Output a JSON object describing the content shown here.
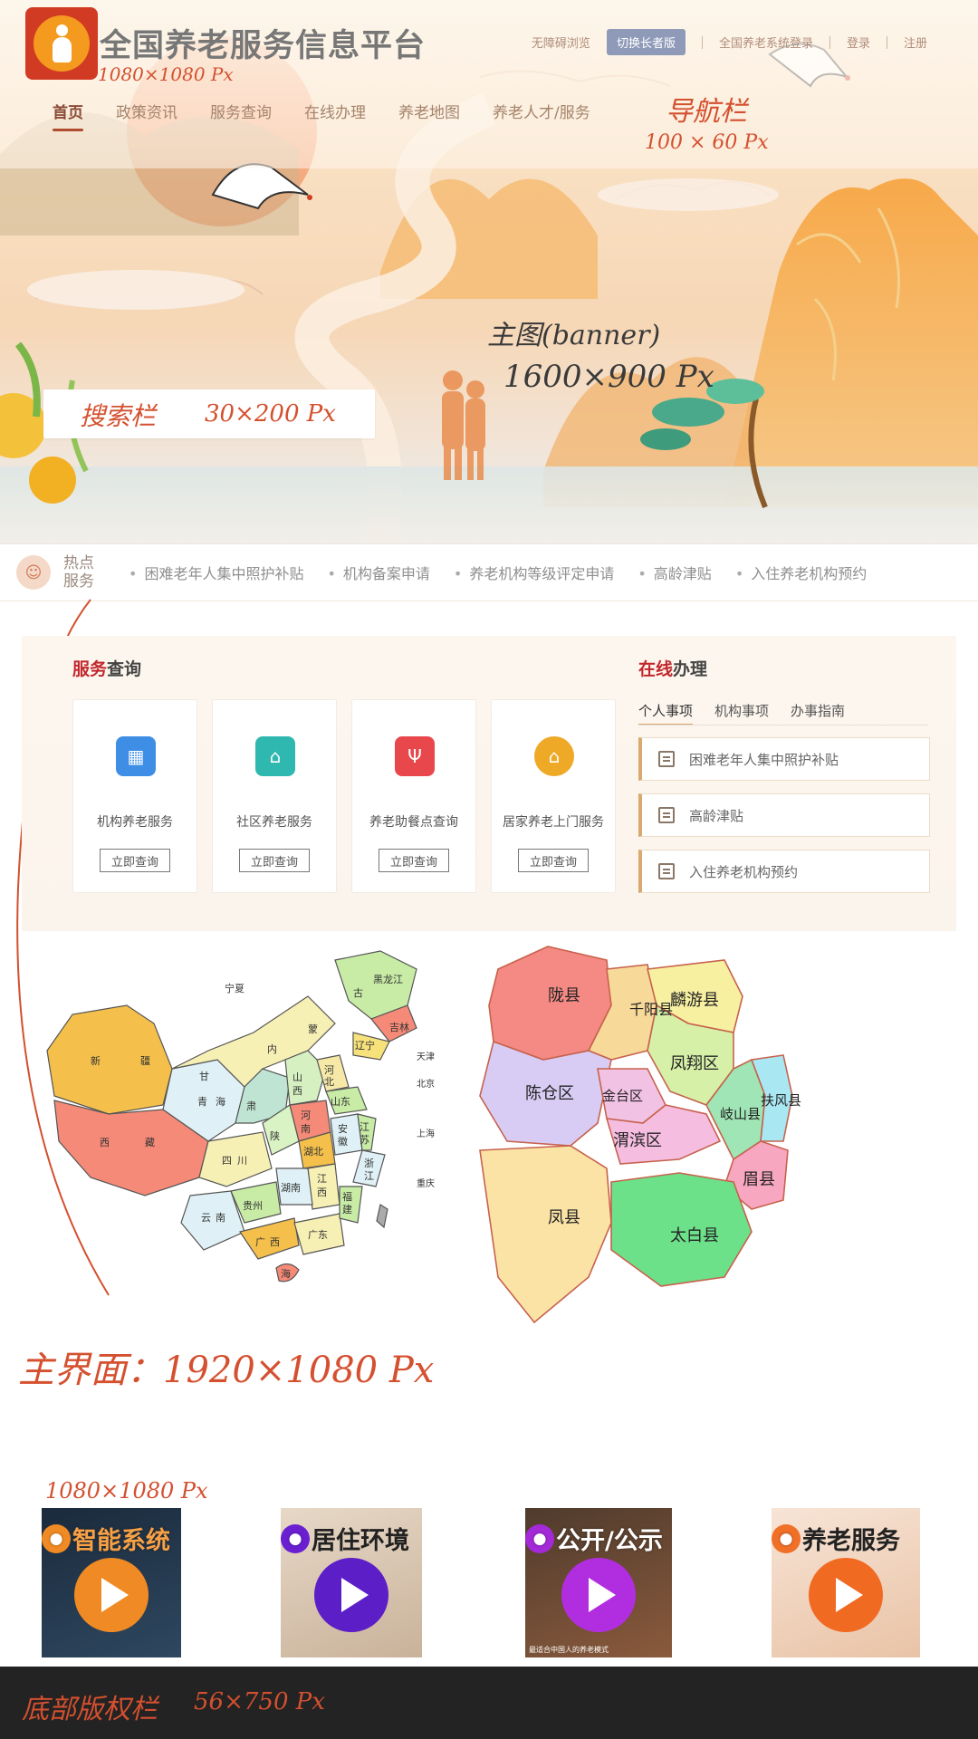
{
  "header": {
    "site_title": "全国养老服务信息平台",
    "top_links": {
      "accessibility": "无障碍浏览",
      "elder_mode": "切换长者版",
      "system_login": "全国养老系统登录",
      "login": "登录",
      "register": "注册"
    },
    "nav": [
      {
        "label": "首页",
        "active": true
      },
      {
        "label": "政策资讯"
      },
      {
        "label": "服务查询"
      },
      {
        "label": "在线办理"
      },
      {
        "label": "养老地图"
      },
      {
        "label": "养老人才/服务"
      }
    ]
  },
  "annotations": {
    "logo_size": "1080×1080 Px",
    "nav_label": "导航栏",
    "nav_size": "100 × 60 Px",
    "banner_label": "主图(banner)",
    "banner_size": "1600×900 Px",
    "search_label": "搜索栏",
    "search_size": "30×200 Px",
    "main_label": "主界面：1920×1080 Px",
    "thumb_size": "1080×1080 Px",
    "footer_label": "底部版权栏",
    "footer_size": "56×750 Px"
  },
  "hot": {
    "title": "热点服务",
    "items": [
      "困难老年人集中照护补贴",
      "机构备案申请",
      "养老机构等级评定申请",
      "高龄津贴",
      "入住养老机构预约"
    ]
  },
  "service_query": {
    "title_accent": "服务",
    "title_rest": "查询",
    "cards": [
      {
        "label": "机构养老服务",
        "button": "立即查询",
        "color": "#3e8ee6",
        "icon": "building-icon"
      },
      {
        "label": "社区养老服务",
        "button": "立即查询",
        "color": "#2fb8b0",
        "icon": "home-icon"
      },
      {
        "label": "养老助餐点查询",
        "button": "立即查询",
        "color": "#e8474c",
        "icon": "fork-icon"
      },
      {
        "label": "居家养老上门服务",
        "button": "立即查询",
        "color": "#eea927",
        "icon": "house-icon"
      }
    ]
  },
  "online": {
    "title_accent": "在线",
    "title_rest": "办理",
    "tabs": [
      "个人事项",
      "机构事项",
      "办事指南"
    ],
    "items": [
      "困难老年人集中照护补贴",
      "高龄津贴",
      "入住养老机构预约"
    ]
  },
  "china_map": {
    "labels": [
      "宁夏",
      "新",
      "疆",
      "甘",
      "内",
      "蒙",
      "古",
      "黑龙江",
      "吉林",
      "辽宁",
      "青",
      "海",
      "肃",
      "山",
      "西",
      "河",
      "北",
      "陕",
      "山东",
      "西",
      "藏",
      "四",
      "川",
      "河",
      "南",
      "湖北",
      "安",
      "徽",
      "江",
      "苏",
      "浙",
      "江",
      "云",
      "南",
      "贵州",
      "湖南",
      "江",
      "西",
      "福",
      "建",
      "广",
      "西",
      "广东",
      "海",
      "天津",
      "北京",
      "上海",
      "重庆"
    ]
  },
  "county_map": {
    "regions": [
      "陇县",
      "千阳县",
      "麟游县",
      "陈仓区",
      "凤翔区",
      "岐山县",
      "扶风县",
      "金台区",
      "渭滨区",
      "眉县",
      "凤县",
      "太白县"
    ]
  },
  "thumbnails": [
    {
      "label": "智能系统",
      "avatar_color": "#f08a24",
      "play_color": "#f08a24"
    },
    {
      "label": "居住环境",
      "avatar_color": "#6a1fd1",
      "play_color": "#5b1ec7"
    },
    {
      "label": "公开/公示",
      "avatar_color": "#a32ad6",
      "play_color": "#b12ee0",
      "caption": "最适合中国人的养老模式"
    },
    {
      "label": "养老服务",
      "avatar_color": "#f07028",
      "play_color": "#f06a22"
    }
  ]
}
